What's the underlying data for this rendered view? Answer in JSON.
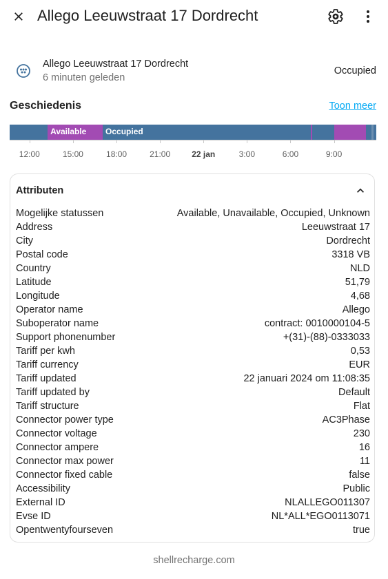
{
  "header": {
    "title": "Allego Leeuwstraat 17 Dordrecht",
    "close_icon": "close-icon",
    "settings_icon": "gear-icon",
    "more_icon": "more-vert-icon"
  },
  "entity": {
    "icon": "ev-plug-icon",
    "name": "Allego Leeuwstraat 17 Dordrecht",
    "last_changed": "6 minuten geleden",
    "state": "Occupied"
  },
  "history": {
    "title": "Geschiedenis",
    "show_more": "Toon meer",
    "segments": [
      {
        "state": "Occupied",
        "label": "",
        "color": "#44739e",
        "from": 10.63,
        "to": 13.25
      },
      {
        "state": "Available",
        "label": "Available",
        "color": "#a24bb3",
        "from": 13.25,
        "to": 17.05
      },
      {
        "state": "Occupied",
        "label": "Occupied",
        "color": "#44739e",
        "from": 17.05,
        "to": 31.4
      },
      {
        "state": "Available",
        "label": "",
        "color": "#a24bb3",
        "from": 31.4,
        "to": 31.5
      },
      {
        "state": "Occupied",
        "label": "",
        "color": "#44739e",
        "from": 31.5,
        "to": 33.0
      },
      {
        "state": "Available",
        "label": "",
        "color": "#a24bb3",
        "from": 33.0,
        "to": 35.2
      },
      {
        "state": "Occupied",
        "label": "",
        "color": "#44739e",
        "from": 35.2,
        "to": 35.6
      },
      {
        "state": "Unavailable",
        "label": "",
        "color": "#6c8fb0",
        "from": 35.6,
        "to": 35.75
      },
      {
        "state": "Occupied",
        "label": "",
        "color": "#44739e",
        "from": 35.75,
        "to": 35.92
      }
    ],
    "range_start": 10.63,
    "range_end": 35.92,
    "ticks": [
      {
        "label": "12:00",
        "hour": 12,
        "bold": false
      },
      {
        "label": "15:00",
        "hour": 15,
        "bold": false
      },
      {
        "label": "18:00",
        "hour": 18,
        "bold": false
      },
      {
        "label": "21:00",
        "hour": 21,
        "bold": false
      },
      {
        "label": "22 jan",
        "hour": 24,
        "bold": true
      },
      {
        "label": "3:00",
        "hour": 27,
        "bold": false
      },
      {
        "label": "6:00",
        "hour": 30,
        "bold": false
      },
      {
        "label": "9:00",
        "hour": 33,
        "bold": false
      }
    ]
  },
  "attributes": {
    "title": "Attributen",
    "toggle_icon": "chevron-up-icon",
    "rows": [
      {
        "key": "Mogelijke statussen",
        "value": "Available, Unavailable, Occupied, Unknown"
      },
      {
        "key": "Address",
        "value": "Leeuwstraat 17"
      },
      {
        "key": "City",
        "value": "Dordrecht"
      },
      {
        "key": "Postal code",
        "value": "3318 VB"
      },
      {
        "key": "Country",
        "value": "NLD"
      },
      {
        "key": "Latitude",
        "value": "51,79"
      },
      {
        "key": "Longitude",
        "value": "4,68"
      },
      {
        "key": "Operator name",
        "value": "Allego"
      },
      {
        "key": "Suboperator name",
        "value": "contract: 0010000104-5"
      },
      {
        "key": "Support phonenumber",
        "value": "+(31)-(88)-0333033"
      },
      {
        "key": "Tariff per kwh",
        "value": "0,53"
      },
      {
        "key": "Tariff currency",
        "value": "EUR"
      },
      {
        "key": "Tariff updated",
        "value": "22 januari 2024 om 11:08:35"
      },
      {
        "key": "Tariff updated by",
        "value": "Default"
      },
      {
        "key": "Tariff structure",
        "value": "Flat"
      },
      {
        "key": "Connector power type",
        "value": "AC3Phase"
      },
      {
        "key": "Connector voltage",
        "value": "230"
      },
      {
        "key": "Connector ampere",
        "value": "16"
      },
      {
        "key": "Connector max power",
        "value": "11"
      },
      {
        "key": "Connector fixed cable",
        "value": "false"
      },
      {
        "key": "Accessibility",
        "value": "Public"
      },
      {
        "key": "External ID",
        "value": "NLALLEGO011307"
      },
      {
        "key": "Evse ID",
        "value": "NL*ALL*EGO0113071"
      },
      {
        "key": "Opentwentyfourseven",
        "value": "true"
      }
    ]
  },
  "footer": {
    "attribution": "shellrecharge.com"
  }
}
